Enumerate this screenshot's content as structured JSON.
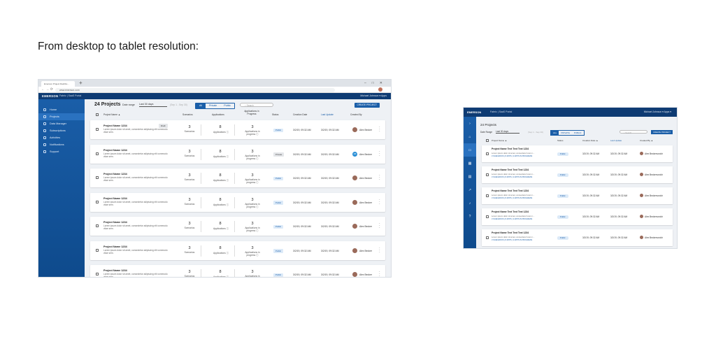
{
  "page_title": "From desktop to tablet resolution:",
  "desktop": {
    "browser_tab": "Emerson Project Dashbo...",
    "url": "www.emerson.com",
    "brand": "EMERSON",
    "breadcrumb": "Fabric  |  SaaS Portal",
    "user": "Michael Johnson  ▾   Apps",
    "sidebar": [
      "Home",
      "Projects",
      "Data Manager",
      "Subscriptions",
      "Activities",
      "Notifications",
      "Support"
    ],
    "count": "24 Projects",
    "date_range_label": "Date range",
    "date_range_value": "Last 30 days",
    "date_range_span": "(Sep 1 - Sep 30)",
    "filters": [
      "All",
      "Private",
      "Public"
    ],
    "search_placeholder": "Search",
    "create_button": "CREATE PROJECT",
    "columns": [
      "Project Name ▲",
      "Scenarios",
      "Applications",
      "Applications in Progress",
      "Status",
      "Creation Date",
      "Last Update",
      "Created By"
    ],
    "rows": [
      {
        "name": "Project Name 1234",
        "desc": "Lorem ipsum dolor sit amet, consectetur adipiscing elit commodo vitae sem.",
        "draft": "Draft",
        "scen": "3",
        "scen_l": "Scenarios",
        "apps": "8",
        "apps_l": "Applications ⓘ",
        "prog": "3",
        "prog_l": "Applications in progress ⓘ",
        "status": "Public",
        "created": "3/2/19, 09:32 AM",
        "updated": "3/2/19, 09:32 AM",
        "avatar": "",
        "by": "Alex Becker"
      },
      {
        "name": "Project Name 1234",
        "desc": "Lorem ipsum dolor sit amet, consectetur adipiscing elit commodo vitae sem.",
        "draft": "",
        "scen": "3",
        "scen_l": "Scenarios",
        "apps": "8",
        "apps_l": "Applications ⓘ",
        "prog": "3",
        "prog_l": "Applications in progress ⓘ",
        "status": "Private",
        "created": "3/2/19, 09:32 AM",
        "updated": "3/2/19, 09:32 AM",
        "avatar": "AB",
        "by": "Alex Becker"
      },
      {
        "name": "Project Name 1234",
        "desc": "Lorem ipsum dolor sit amet, consectetur adipiscing elit commodo vitae sem.",
        "draft": "",
        "scen": "3",
        "scen_l": "Scenarios",
        "apps": "8",
        "apps_l": "Applications ⓘ",
        "prog": "3",
        "prog_l": "Applications in progress ⓘ",
        "status": "Public",
        "created": "3/2/19, 09:32 AM",
        "updated": "3/2/19, 09:32 AM",
        "avatar": "",
        "by": "Alex Becker"
      },
      {
        "name": "Project Name 1234",
        "desc": "Lorem ipsum dolor sit amet, consectetur adipiscing elit commodo vitae sem.",
        "draft": "",
        "scen": "3",
        "scen_l": "Scenarios",
        "apps": "8",
        "apps_l": "Applications ⓘ",
        "prog": "3",
        "prog_l": "Applications in progress ⓘ",
        "status": "Public",
        "created": "3/2/19, 09:32 AM",
        "updated": "3/2/19, 09:32 AM",
        "avatar": "",
        "by": "Alex Becker"
      },
      {
        "name": "Project Name 1234",
        "desc": "Lorem ipsum dolor sit amet, consectetur adipiscing elit commodo vitae sem.",
        "draft": "",
        "scen": "3",
        "scen_l": "Scenarios",
        "apps": "8",
        "apps_l": "Applications ⓘ",
        "prog": "3",
        "prog_l": "Applications in progress ⓘ",
        "status": "Public",
        "created": "3/2/19, 09:32 AM",
        "updated": "3/2/19, 09:32 AM",
        "avatar": "",
        "by": "Alex Becker"
      },
      {
        "name": "Project Name 1234",
        "desc": "Lorem ipsum dolor sit amet, consectetur adipiscing elit commodo vitae sem.",
        "draft": "",
        "scen": "3",
        "scen_l": "Scenarios",
        "apps": "8",
        "apps_l": "Applications ⓘ",
        "prog": "3",
        "prog_l": "Applications in progress ⓘ",
        "status": "Public",
        "created": "3/2/19, 09:32 AM",
        "updated": "3/2/19, 09:32 AM",
        "avatar": "",
        "by": "Alex Becker"
      },
      {
        "name": "Project Name 1234",
        "desc": "Lorem ipsum dolor sit amet, consectetur adipiscing elit commodo vitae sem.",
        "draft": "",
        "scen": "3",
        "scen_l": "Scenarios",
        "apps": "8",
        "apps_l": "Applications ⓘ",
        "prog": "3",
        "prog_l": "Applications in progress ⓘ",
        "status": "Public",
        "created": "3/2/19, 09:32 AM",
        "updated": "3/2/19, 09:32 AM",
        "avatar": "",
        "by": "Alex Becker"
      }
    ]
  },
  "tablet": {
    "brand": "EMERSON",
    "breadcrumb": "Fabric  |  SaaS Portal",
    "user": "Michael Johnson ▾    Apps ▾",
    "count": "24 Projects",
    "date_range_label": "Date Range",
    "date_range_value": "Last 30 days",
    "date_range_span": "(Sep 1 - Sep 30)",
    "filters": [
      "ALL",
      "PRIVATE",
      "PUBLIC"
    ],
    "search_placeholder": "Search",
    "create_button": "CREATE PROJECT",
    "columns": [
      "Project Name ▲",
      "Status",
      "Creation Date ▲",
      "Last Update",
      "Created By ▲"
    ],
    "rows": [
      {
        "name": "Project Name Text Text Text 1234",
        "desc": "Lorem ipsum dolor sit amet, consectetur lorem i...",
        "links": "3 SCENARIOS  |  8 APPS  |  3 APPS IN PROGRESS",
        "status": "Public",
        "created": "3/2/19, 09:32 AM",
        "updated": "3/2/19, 09:32 AM",
        "by": "Alex Beckersovich"
      },
      {
        "name": "Project Name Text Text Text 1234",
        "desc": "Lorem ipsum dolor sit amet, consectetur lorem i...",
        "links": "3 SCENARIOS  |  8 APPS  |  3 APPS IN PROGRESS",
        "status": "Public",
        "created": "3/2/19, 09:32 AM",
        "updated": "3/2/19, 09:32 AM",
        "by": "Alex Beckersovich"
      },
      {
        "name": "Project Name Text Text Text 1234",
        "desc": "Lorem ipsum dolor sit amet, consectetur lorem i...",
        "links": "3 SCENARIOS  |  8 APPS  |  3 APPS IN PROGRESS",
        "status": "Public",
        "created": "3/2/19, 09:32 AM",
        "updated": "3/2/19, 09:32 AM",
        "by": "Alex Beckersovich"
      },
      {
        "name": "Project Name Text Text Text 1234",
        "desc": "Lorem ipsum dolor sit amet, consectetur lorem i...",
        "links": "3 SCENARIOS  |  8 APPS  |  3 APPS IN PROGRESS",
        "status": "Public",
        "created": "3/2/19, 09:32 AM",
        "updated": "3/2/19, 09:32 AM",
        "by": "Alex Beckersovich"
      },
      {
        "name": "Project Name Text Text Text 1234",
        "desc": "Lorem ipsum dolor sit amet, consectetur lorem i...",
        "links": "3 SCENARIOS  |  8 APPS  |  3 APPS IN PROGRESS",
        "status": "Public",
        "created": "3/2/19, 09:32 AM",
        "updated": "3/2/19, 09:32 AM",
        "by": "Alex Beckersovich"
      }
    ]
  }
}
